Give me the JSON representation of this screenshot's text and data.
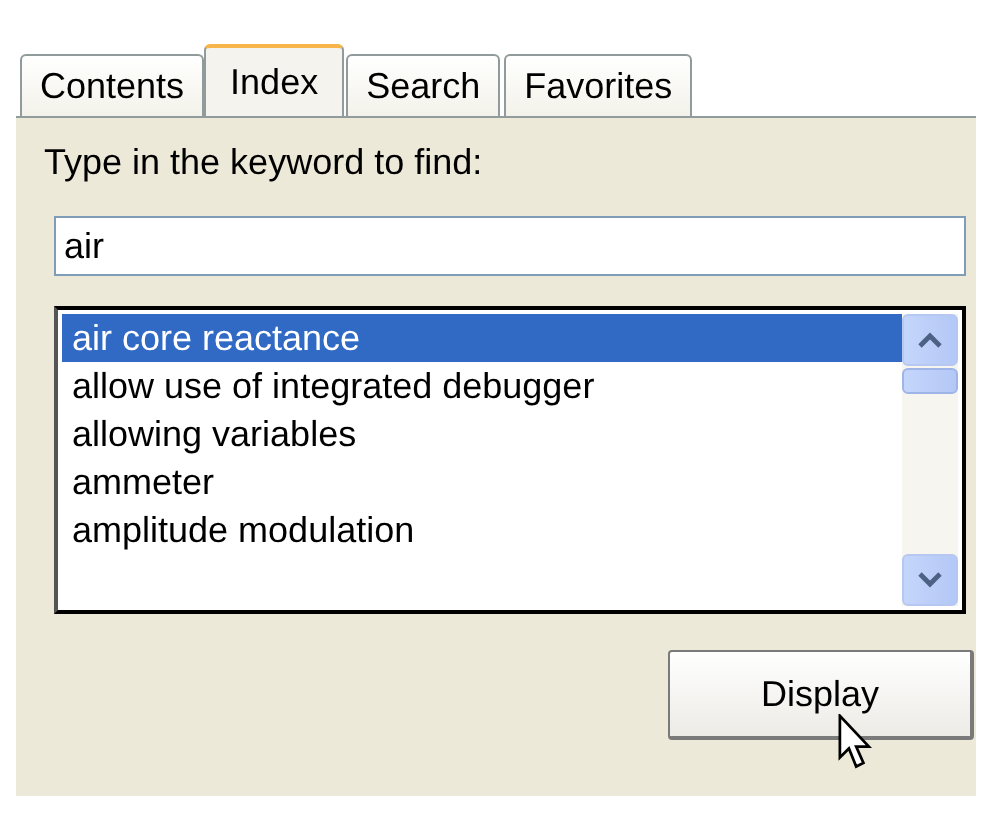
{
  "tabs": [
    {
      "label": "Contents",
      "selected": false
    },
    {
      "label": "Index",
      "selected": true
    },
    {
      "label": "Search",
      "selected": false
    },
    {
      "label": "Favorites",
      "selected": false
    }
  ],
  "keyword": {
    "label": "Type in the keyword to find:",
    "value": "air"
  },
  "index_list": [
    {
      "label": "air core reactance",
      "selected": true
    },
    {
      "label": "allow use of integrated debugger",
      "selected": false
    },
    {
      "label": "allowing variables",
      "selected": false
    },
    {
      "label": "ammeter",
      "selected": false
    },
    {
      "label": "amplitude modulation",
      "selected": false
    }
  ],
  "display_button": {
    "label": "Display"
  }
}
